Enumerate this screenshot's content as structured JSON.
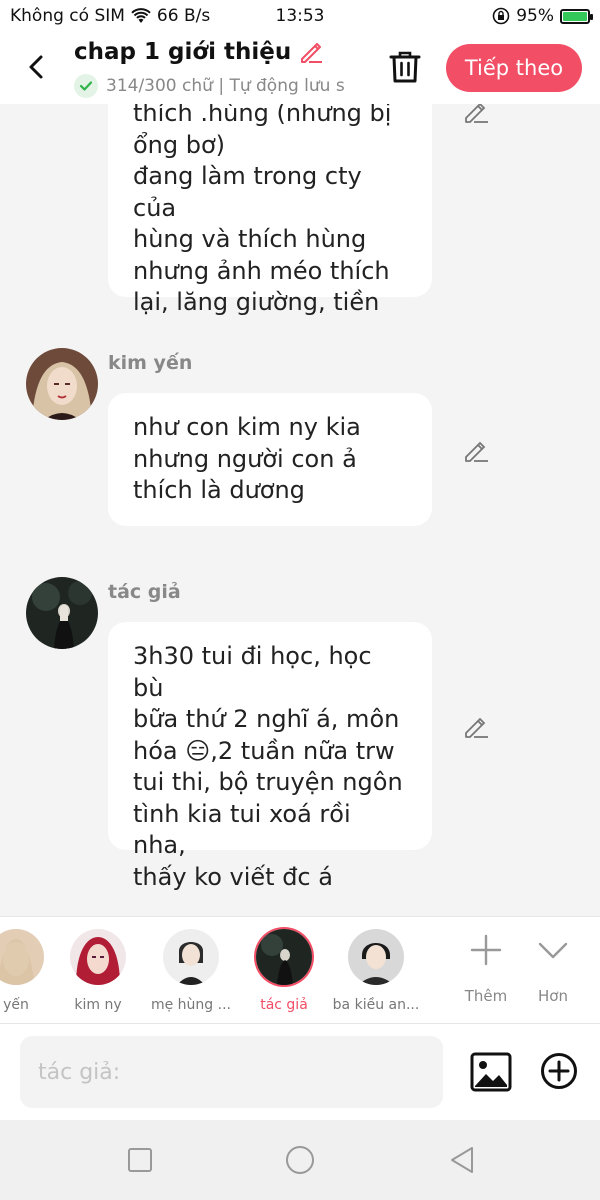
{
  "status_bar": {
    "carrier": "Không có SIM",
    "speed": "66 B/s",
    "time": "13:53",
    "battery": "95%",
    "battery_level": 0.95
  },
  "header": {
    "title": "chap 1 giới thiệu",
    "subtitle": "314/300 chữ | Tự động lưu s",
    "next_label": "Tiếp theo",
    "accent_color": "#f24e66"
  },
  "messages": [
    {
      "speaker": "",
      "lines": [
        "thích .hùng (nhưng bị",
        "ổng bơ)",
        "đang làm trong cty của",
        "hùng và thích hùng",
        "nhưng ảnh méo thích",
        "lại, lăng giường, tiền"
      ]
    },
    {
      "speaker": "kim yến",
      "lines": [
        "như con kim ny kia",
        "nhưng người con ả",
        "thích là dương"
      ]
    },
    {
      "speaker": "tác giả",
      "lines": [
        "3h30 tui đi học, học bù",
        "bữa thứ 2 nghĩ á, môn",
        "hóa 😑,2 tuần nữa trw",
        "tui thi,  bộ truyện ngôn",
        "tình kia tui xoá rồi nha,",
        "thấy ko viết đc á"
      ]
    }
  ],
  "characters": [
    {
      "name": "yến"
    },
    {
      "name": "kim ny"
    },
    {
      "name": "mẹ hùng ..."
    },
    {
      "name": "tác giả",
      "active": true
    },
    {
      "name": "ba kiều an..."
    }
  ],
  "tools": {
    "add_label": "Thêm",
    "more_label": "Hơn"
  },
  "input": {
    "placeholder": "tác giả:"
  }
}
